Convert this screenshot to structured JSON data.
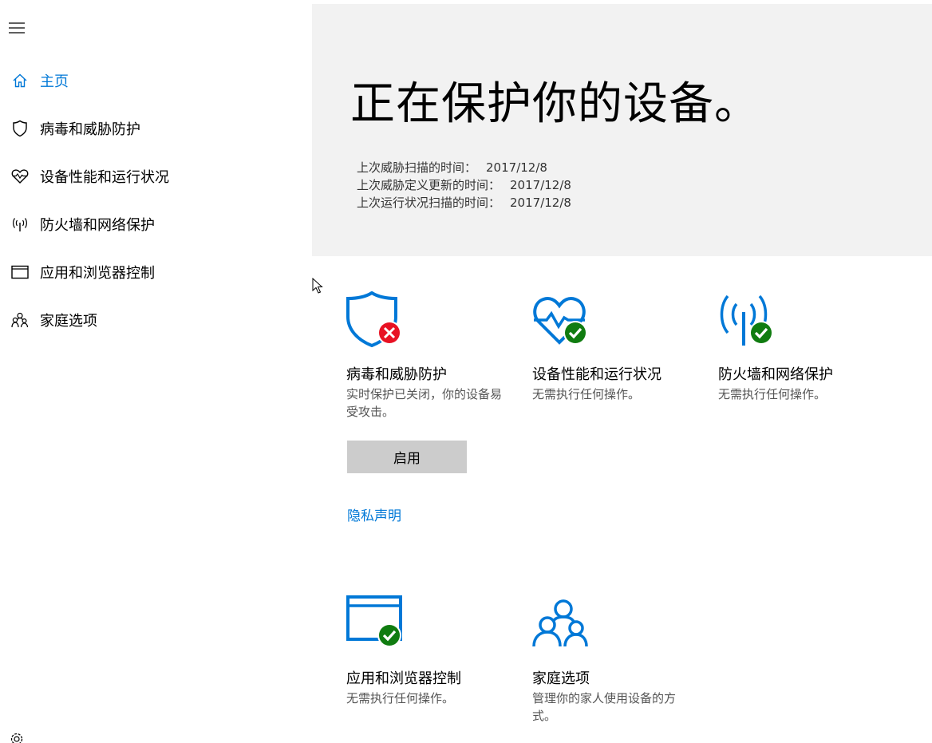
{
  "sidebar": {
    "items": [
      {
        "label": "主页",
        "icon": "home-icon",
        "active": true
      },
      {
        "label": "病毒和威胁防护",
        "icon": "shield-icon",
        "active": false
      },
      {
        "label": "设备性能和运行状况",
        "icon": "heart-icon",
        "active": false
      },
      {
        "label": "防火墙和网络保护",
        "icon": "antenna-icon",
        "active": false
      },
      {
        "label": "应用和浏览器控制",
        "icon": "browser-window-icon",
        "active": false
      },
      {
        "label": "家庭选项",
        "icon": "family-icon",
        "active": false
      }
    ]
  },
  "hero": {
    "title": "正在保护你的设备。",
    "scans": [
      {
        "label": "上次威胁扫描的时间：",
        "value": "2017/12/8"
      },
      {
        "label": "上次威胁定义更新的时间：",
        "value": "2017/12/8"
      },
      {
        "label": "上次运行状况扫描的时间：",
        "value": "2017/12/8"
      }
    ]
  },
  "tiles": [
    {
      "title": "病毒和威胁防护",
      "desc": "实时保护已关闭，你的设备易受攻击。",
      "status": "error"
    },
    {
      "title": "设备性能和运行状况",
      "desc": "无需执行任何操作。",
      "status": "ok"
    },
    {
      "title": "防火墙和网络保护",
      "desc": "无需执行任何操作。",
      "status": "ok"
    },
    {
      "title": "应用和浏览器控制",
      "desc": "无需执行任何操作。",
      "status": "ok"
    },
    {
      "title": "家庭选项",
      "desc": "管理你的家人使用设备的方式。",
      "status": "none"
    }
  ],
  "actions": {
    "enable_label": "启用",
    "privacy_label": "隐私声明"
  },
  "colors": {
    "accent": "#0078d7",
    "ok": "#107c10",
    "error": "#e81123",
    "hero_bg": "#f2f2f2"
  }
}
